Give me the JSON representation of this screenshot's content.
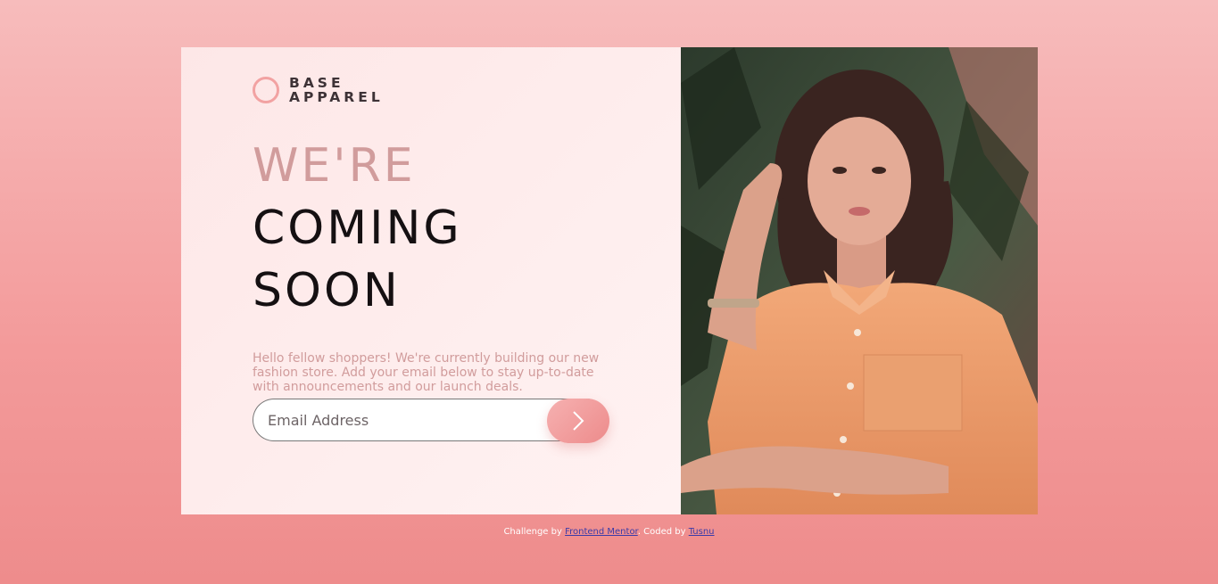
{
  "brand": {
    "line1": "BASE",
    "line2": "APPAREL"
  },
  "headline": {
    "light": "WE'RE",
    "line2": "COMING",
    "line3": "SOON"
  },
  "intro": "Hello fellow shoppers! We're currently building our new fashion store. Add your email below to stay up-to-date with announcements and our launch deals.",
  "form": {
    "email_placeholder": "Email Address",
    "submit_icon": "chevron-right-icon"
  },
  "hero_image": {
    "subject": "woman-in-orange-shirt-photo"
  },
  "footer": {
    "prefix": "Challenge by",
    "link1": "Frontend Mentor",
    "middle": ". Coded by",
    "link2": "Tusnu"
  },
  "colors": {
    "accent": "#f2a2a2",
    "headline_light": "#d19c9c",
    "headline_dark": "#151012",
    "background_top": "#f7bcbc",
    "background_bottom": "#ee8c8c"
  }
}
